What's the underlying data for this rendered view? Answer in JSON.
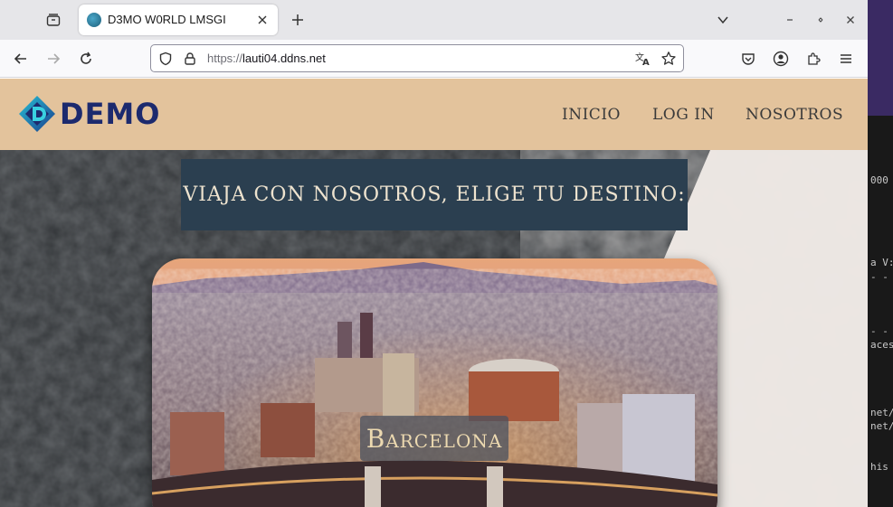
{
  "browser": {
    "tab_title": "D3MO W0RLD LMSGI",
    "url_scheme": "https://",
    "url_host": "lauti04.ddns.net"
  },
  "site": {
    "logo_text": "DEMO",
    "nav": [
      "INICIO",
      "LOG IN",
      "NOSOTROS"
    ],
    "hero_title": "VIAJA CON NOSOTROS, ELIGE TU DESTINO:",
    "destination": "Barcelona"
  },
  "terminal": {
    "lines": [
      "000",
      "a V:",
      "- -",
      "- -",
      "aces",
      "net/",
      "net/p",
      "his c"
    ]
  },
  "colors": {
    "header_bg": "#e3c39c",
    "logo_blue": "#1c2a6e",
    "title_box": "#2b3f50"
  }
}
